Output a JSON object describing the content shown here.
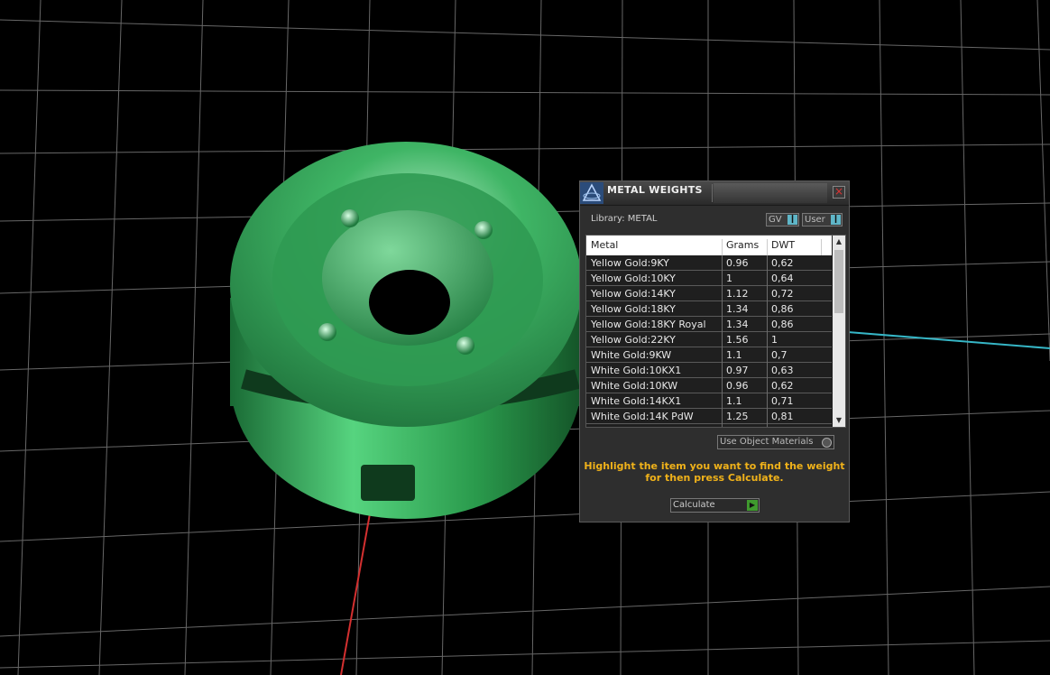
{
  "window": {
    "title": "METAL WEIGHTS",
    "close_glyph": "×"
  },
  "library": {
    "label": "Library: METAL"
  },
  "toggles": {
    "gv_label": "GV",
    "user_label": "User"
  },
  "table": {
    "headers": [
      "Metal",
      "Grams",
      "DWT"
    ],
    "rows": [
      {
        "metal": "Yellow Gold:9KY",
        "grams": "0.96",
        "dwt": "0,62"
      },
      {
        "metal": "Yellow Gold:10KY",
        "grams": "1",
        "dwt": "0,64"
      },
      {
        "metal": "Yellow Gold:14KY",
        "grams": "1.12",
        "dwt": "0,72"
      },
      {
        "metal": "Yellow Gold:18KY",
        "grams": "1.34",
        "dwt": "0,86"
      },
      {
        "metal": "Yellow Gold:18KY Royal",
        "grams": "1.34",
        "dwt": "0,86"
      },
      {
        "metal": "Yellow Gold:22KY",
        "grams": "1.56",
        "dwt": "1"
      },
      {
        "metal": "White Gold:9KW",
        "grams": "1.1",
        "dwt": "0,7"
      },
      {
        "metal": "White Gold:10KX1",
        "grams": "0.97",
        "dwt": "0,63"
      },
      {
        "metal": "White Gold:10KW",
        "grams": "0.96",
        "dwt": "0,62"
      },
      {
        "metal": "White Gold:14KX1",
        "grams": "1.1",
        "dwt": "0,71"
      },
      {
        "metal": "White Gold:14K PdW",
        "grams": "1.25",
        "dwt": "0,81"
      }
    ]
  },
  "options": {
    "use_object_materials": "Use Object Materials"
  },
  "instruction": {
    "line1": "Highlight the item you want to find the weight",
    "line2": "for then press Calculate."
  },
  "actions": {
    "calculate_label": "Calculate"
  },
  "colors": {
    "model": "#2fa850",
    "instruction": "#f0b21a",
    "accent": "#5fb6c8"
  }
}
